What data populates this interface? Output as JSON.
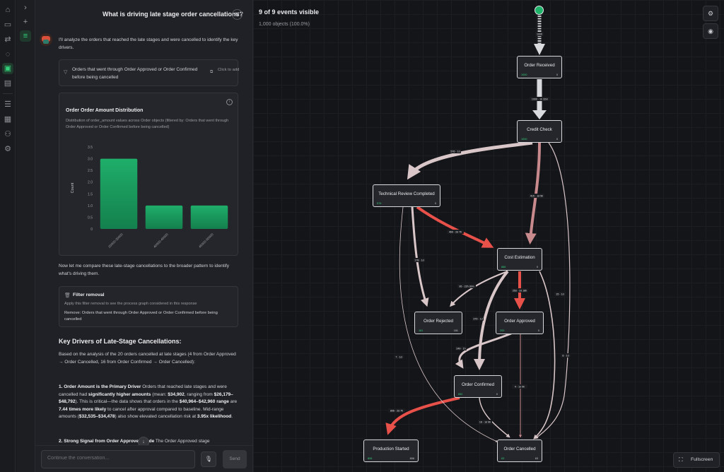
{
  "chat": {
    "question": "What is driving late stage order cancellations?",
    "user_initial": "U",
    "intro": "I'll analyze the orders that reached the late stages and were cancelled to identify the key drivers.",
    "filter_text": "Orders that went through Order Approved or Order Confirmed before being cancelled",
    "filter_cta": "Click to add",
    "chart_title": "Order Order Amount Distribution",
    "chart_subtitle": "Distribution of order_amount values across Order objects (filtered by: Orders that went through Order Approved or Order Confirmed before being cancelled)",
    "compare_text": "Now let me compare these late-stage cancellations to the broader pattern to identify what's driving them.",
    "removal_title": "Filter removal",
    "removal_sub": "Apply this filter removal to see the process graph considered in this response",
    "removal_detail": "Remove: Orders that went through Order Approved or Order Confirmed before being cancelled",
    "section_heading": "Key Drivers of Late-Stage Cancellations:",
    "analysis_text": "Based on the analysis of the 20 orders cancelled at late stages (4 from Order Approved → Order Cancelled, 16 from Order Confirmed → Order Cancelled):",
    "point1": {
      "title": "1. Order Amount is the Primary Driver",
      "t1": " Orders that reached late stages and were cancelled had ",
      "b1": "significantly higher amounts",
      "t2": " (mean: ",
      "b2": "$34,902",
      "t3": ", ranging from ",
      "b3": "$26,179–$48,792",
      "t4": "). This is critical—the data shows that orders in the ",
      "b4": "$40,964–$42,960 range",
      "t5": " are ",
      "b5": "7.44 times more likely",
      "t6": " to cancel after approval compared to baseline. Mid-range amounts (",
      "b6": "$32,535–$34,478",
      "t7": ") also show elevated cancellation risk at ",
      "b7": "3.95x likelihood",
      "t8": "."
    },
    "point2_title": "2. Strong Signal from Order Approved Node",
    "point2_text": " The Order Approved stage",
    "input_placeholder": "Continue the conversation...",
    "send_label": "Send"
  },
  "chart_data": {
    "type": "bar",
    "categories": [
      "20000-30000",
      "40000-45000",
      "45000-50000"
    ],
    "values": [
      3,
      1,
      1
    ],
    "ylabel": "Count",
    "xlabel": "",
    "yticks": [
      "0",
      "0.5",
      "1.0",
      "1.5",
      "2.0",
      "2.5",
      "3.0",
      "3.5"
    ],
    "ylim": [
      0,
      3.5
    ],
    "bar_color": "#1fae6a",
    "grid": false
  },
  "graph": {
    "title": "9 of 9 events visible",
    "subtitle": "1,000 objects (100.0%)",
    "fullscreen_label": "Fullscreen",
    "nodes": [
      {
        "name": "Order Received",
        "left": "1000",
        "right": "0"
      },
      {
        "name": "Credit Check",
        "left": "1000",
        "right": "0"
      },
      {
        "name": "Technical Review Completed",
        "left": "576",
        "right": "0"
      },
      {
        "name": "Cost Estimation",
        "left": "886",
        "right": "0"
      },
      {
        "name": "Order Rejected",
        "left": "181",
        "right": "181"
      },
      {
        "name": "Order Approved",
        "left": "253",
        "right": "0"
      },
      {
        "name": "Order Confirmed",
        "left": "652",
        "right": "0"
      },
      {
        "name": "Production Started",
        "left": "806",
        "right": "806"
      },
      {
        "name": "Order Cancelled",
        "left": "63",
        "right": "63"
      }
    ],
    "edge_labels": {
      "start": "1000",
      "received_credit": "1000 · 1h 32m",
      "credit_tech": "576 · 1d",
      "credit_cost": "415 · 1d 5h",
      "tech_cost": "469 · 2d 7h",
      "tech_rejected": "178 · 1d",
      "cost_rejected": "95 · 22h 30m",
      "cost_approved": "253 · 2d 18h",
      "cost_confirmed": "379 · 1d",
      "approved_confirmed": "249 · 1h",
      "confirmed_production": "806 · 2d 7h",
      "confirmed_cancelled": "16 · 1d 9h",
      "approved_cancelled": "4 · 1d 9h",
      "tech_cancelled": "7 · 1d",
      "credit_cancelled": "8 · 1d",
      "cost_cancelled": "15 · 1d"
    }
  },
  "colors": {
    "accent": "#33d17a",
    "edge_light": "#d9c6c8",
    "edge_mid": "#c98a8d",
    "edge_hot": "#e8504a"
  }
}
